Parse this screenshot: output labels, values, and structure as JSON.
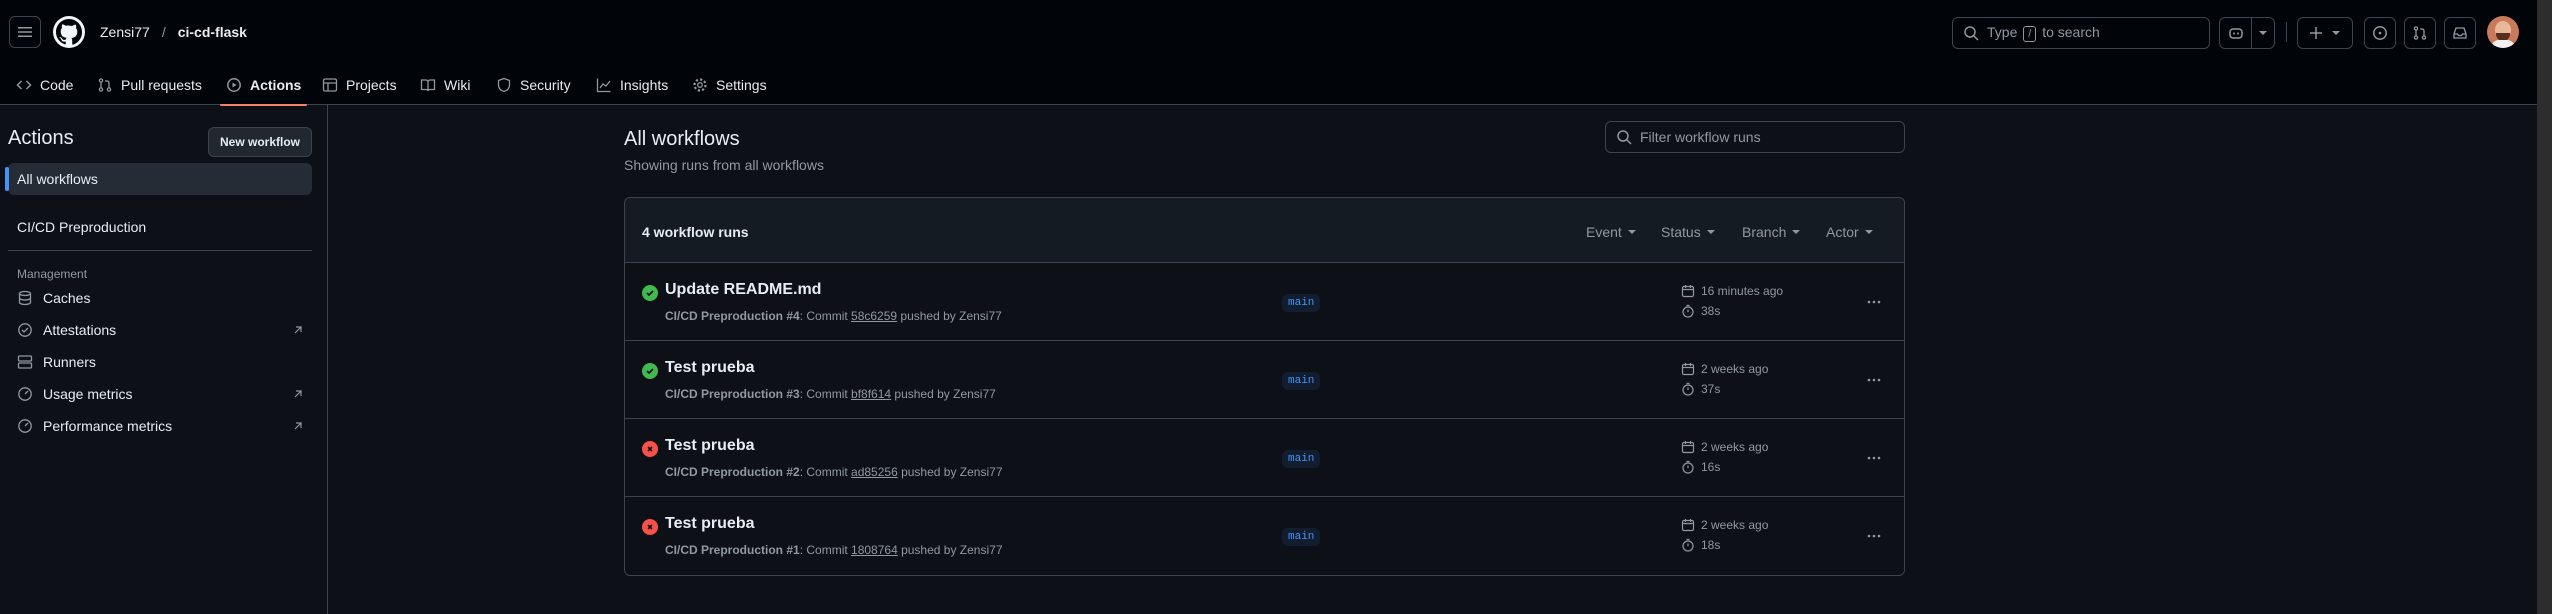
{
  "header": {
    "owner": "Zensi77",
    "separator": "/",
    "repo": "ci-cd-flask",
    "search_prefix": "Type",
    "search_key": "/",
    "search_suffix": "to search"
  },
  "repo_nav": {
    "tabs": [
      {
        "label": "Code",
        "icon": "code-icon"
      },
      {
        "label": "Pull requests",
        "icon": "pull-request-icon"
      },
      {
        "label": "Actions",
        "icon": "play-icon",
        "active": true
      },
      {
        "label": "Projects",
        "icon": "table-icon"
      },
      {
        "label": "Wiki",
        "icon": "book-icon"
      },
      {
        "label": "Security",
        "icon": "shield-icon"
      },
      {
        "label": "Insights",
        "icon": "graph-icon"
      },
      {
        "label": "Settings",
        "icon": "gear-icon"
      }
    ]
  },
  "sidebar": {
    "title": "Actions",
    "new_workflow_label": "New workflow",
    "all_workflows_label": "All workflows",
    "workflows": [
      "CI/CD Preproduction"
    ],
    "management_heading": "Management",
    "management_items": [
      {
        "label": "Caches",
        "icon": "database-icon",
        "external": false
      },
      {
        "label": "Attestations",
        "icon": "verified-icon",
        "external": true
      },
      {
        "label": "Runners",
        "icon": "server-icon",
        "external": false
      },
      {
        "label": "Usage metrics",
        "icon": "meter-icon",
        "external": true
      },
      {
        "label": "Performance metrics",
        "icon": "meter-icon",
        "external": true
      }
    ]
  },
  "main": {
    "title": "All workflows",
    "subtitle": "Showing runs from all workflows",
    "filter_placeholder": "Filter workflow runs",
    "runs_count_label": "4 workflow runs",
    "filters": [
      "Event",
      "Status",
      "Branch",
      "Actor"
    ],
    "runs": [
      {
        "title": "Update README.md",
        "workflow": "CI/CD Preproduction #4",
        "commit_prefix": ": Commit ",
        "sha": "58c6259",
        "pushed_by": " pushed by Zensi77",
        "branch": "main",
        "when": "16 minutes ago",
        "duration": "38s",
        "status": "success"
      },
      {
        "title": "Test prueba",
        "workflow": "CI/CD Preproduction #3",
        "commit_prefix": ": Commit ",
        "sha": "bf8f614",
        "pushed_by": " pushed by Zensi77",
        "branch": "main",
        "when": "2 weeks ago",
        "duration": "37s",
        "status": "success"
      },
      {
        "title": "Test prueba",
        "workflow": "CI/CD Preproduction #2",
        "commit_prefix": ": Commit ",
        "sha": "ad85256",
        "pushed_by": " pushed by Zensi77",
        "branch": "main",
        "when": "2 weeks ago",
        "duration": "16s",
        "status": "failure"
      },
      {
        "title": "Test prueba",
        "workflow": "CI/CD Preproduction #1",
        "commit_prefix": ": Commit ",
        "sha": "1808764",
        "pushed_by": " pushed by Zensi77",
        "branch": "main",
        "when": "2 weeks ago",
        "duration": "18s",
        "status": "failure"
      }
    ]
  },
  "colors": {
    "accent_tab": "#f78166",
    "success": "#3fb950",
    "failure": "#f85149",
    "link": "#4493f8"
  }
}
